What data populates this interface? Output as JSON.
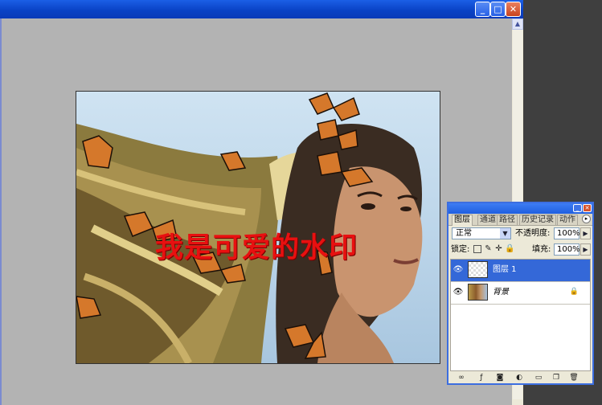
{
  "window": {
    "buttons": {
      "minimize": "_",
      "maximize": "□",
      "close": "✕"
    },
    "scroll_up": "▲"
  },
  "image": {
    "watermark_text": "我是可爱的水印",
    "colors": {
      "sky": "#b9d3e8",
      "watermark": "#e81010",
      "butterfly": "#d5782b"
    }
  },
  "layers_panel": {
    "title_buttons": {
      "minimize": "_",
      "close": "✕"
    },
    "tabs": [
      "图层",
      "通道",
      "路径",
      "历史记录",
      "动作"
    ],
    "menu_icon": "▸",
    "blend_mode": "正常",
    "opacity_label": "不透明度:",
    "opacity_value": "100%",
    "lock_label": "锁定:",
    "fill_label": "填充:",
    "fill_value": "100%",
    "layers": [
      {
        "name": "图层 1",
        "selected": true,
        "visible_icon": "eye-icon",
        "thumbnail": "transparent-checker"
      },
      {
        "name": "背景",
        "selected": false,
        "visible_icon": "eye-icon",
        "thumbnail": "photo",
        "locked": true
      }
    ],
    "bottom_icons": [
      "link-icon",
      "layer-style-icon",
      "mask-icon",
      "adjustment-icon",
      "group-icon",
      "new-layer-icon",
      "trash-icon"
    ]
  },
  "colors": {
    "titlebar": "#0a43c6",
    "selection": "#3468d8",
    "panel_bg": "#ece9d8",
    "canvas_bg": "#b3b3b3"
  }
}
